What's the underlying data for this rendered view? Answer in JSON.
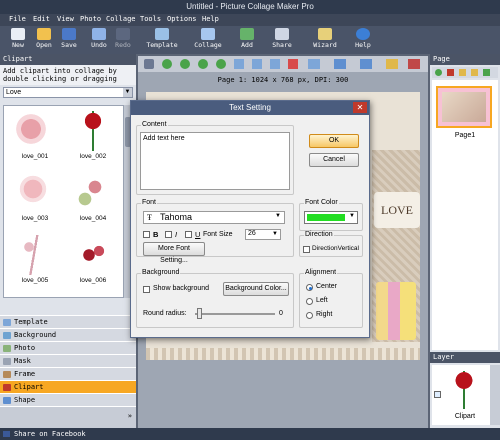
{
  "window": {
    "title": "Untitled - Picture Collage Maker Pro"
  },
  "menu": [
    "File",
    "Edit",
    "View",
    "Photo",
    "Collage",
    "Tools",
    "Options",
    "Help"
  ],
  "toolbar": [
    {
      "label": "New",
      "icon": "new-doc-icon",
      "color": "#e9eef6"
    },
    {
      "label": "Open",
      "icon": "folder-icon",
      "color": "#f2c14e"
    },
    {
      "label": "Save",
      "icon": "floppy-icon",
      "color": "#4b79c9"
    },
    {
      "label": "Undo",
      "icon": "undo-icon",
      "color": "#8fb3e8"
    },
    {
      "label": "Redo",
      "icon": "redo-icon",
      "color": "#6c7892"
    },
    {
      "label": "Template",
      "icon": "template-icon",
      "color": "#9ac0e6"
    },
    {
      "label": "Collage",
      "icon": "collage-icon",
      "color": "#a7c7ef"
    },
    {
      "label": "Add",
      "icon": "add-icon",
      "color": "#66b36a"
    },
    {
      "label": "Share",
      "icon": "share-icon",
      "color": "#cfd6e4"
    },
    {
      "label": "Wizard",
      "icon": "wizard-icon",
      "color": "#e7d07a"
    },
    {
      "label": "Help",
      "icon": "help-icon",
      "color": "#3c7fd6"
    }
  ],
  "left_panel": {
    "header": "Clipart",
    "hint": "Add clipart into collage by double clicking or dragging",
    "category_select": "Love",
    "items": [
      "love_001",
      "love_002",
      "love_003",
      "love_004",
      "love_005",
      "love_006"
    ],
    "categories": [
      "Template",
      "Background",
      "Photo",
      "Mask",
      "Frame",
      "Clipart",
      "Shape"
    ],
    "selected_category": "Clipart"
  },
  "canvas": {
    "page_info": "Page 1: 1024 x 768 px, DPI: 300",
    "love_text": "LOVE"
  },
  "right_panel": {
    "page_header": "Page",
    "page_label": "Page1",
    "layer_header": "Layer",
    "layer_label": "Clipart"
  },
  "status": {
    "share_text": "Share on Facebook"
  },
  "dialog": {
    "title": "Text Setting",
    "content_label": "Content",
    "content_text": "Add text here",
    "ok": "OK",
    "cancel": "Cancel",
    "font_group": "Font",
    "font_name": "Tahoma",
    "bold": "B",
    "italic": "I",
    "underline": "U",
    "font_size_label": "Font Size",
    "font_size": "26",
    "more_font": "More Font Setting...",
    "font_color_group": "Font Color",
    "font_color": "#22dd22",
    "direction_group": "Direction",
    "direction_vertical": "DirectionVertical",
    "background_group": "Background",
    "show_background": "Show background",
    "background_color_btn": "Background Color...",
    "round_radius_label": "Round radius:",
    "round_radius_value": "0",
    "alignment_group": "Alignment",
    "align_center": "Center",
    "align_left": "Left",
    "align_right": "Right"
  }
}
